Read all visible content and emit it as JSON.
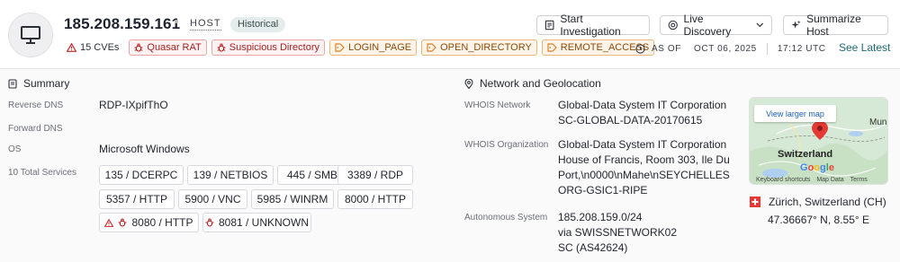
{
  "header": {
    "ip": "185.208.159.161",
    "type_label": "HOST",
    "status_badge": "Historical",
    "tags": [
      {
        "label": "15 CVEs",
        "style": "plain",
        "icon": "warning-icon"
      },
      {
        "label": "Quasar RAT",
        "style": "red",
        "icon": "bug-icon"
      },
      {
        "label": "Suspicious Directory",
        "style": "red",
        "icon": "bug-icon"
      },
      {
        "label": "LOGIN_PAGE",
        "style": "orange",
        "icon": "tag-icon"
      },
      {
        "label": "OPEN_DIRECTORY",
        "style": "orange",
        "icon": "tag-icon"
      },
      {
        "label": "REMOTE_ACCESS",
        "style": "orange",
        "icon": "tag-icon"
      }
    ],
    "actions": {
      "start_investigation": "Start Investigation",
      "live_discovery": "Live Discovery",
      "summarize_host": "Summarize Host"
    },
    "as_of": {
      "label": "AS OF",
      "date": "OCT 06, 2025",
      "time": "17:12 UTC",
      "see_latest": "See Latest"
    }
  },
  "summary": {
    "title": "Summary",
    "reverse_dns_label": "Reverse DNS",
    "reverse_dns_value": "RDP-IXpifThO",
    "forward_dns_label": "Forward DNS",
    "os_label": "OS",
    "os_value": "Microsoft Windows",
    "services_label": "10 Total Services",
    "services": [
      {
        "label": "135 / DCERPC",
        "warning": false
      },
      {
        "label": "139 / NETBIOS",
        "warning": false
      },
      {
        "label": "445 / SMB",
        "warning": false
      },
      {
        "label": "3389 / RDP",
        "warning": false
      },
      {
        "label": "5357 / HTTP",
        "warning": false
      },
      {
        "label": "5900 / VNC",
        "warning": false
      },
      {
        "label": "5985 / WINRM",
        "warning": false
      },
      {
        "label": "8000 / HTTP",
        "warning": false
      },
      {
        "label": "8080 / HTTP",
        "warning": true,
        "bug": true
      },
      {
        "label": "8081 / UNKNOWN",
        "warning": false,
        "bug": true
      }
    ]
  },
  "network": {
    "title": "Network and Geolocation",
    "whois_network_label": "WHOIS Network",
    "whois_network_lines": [
      "Global-Data System IT Corporation",
      "SC-GLOBAL-DATA-20170615"
    ],
    "whois_org_label": "WHOIS Organization",
    "whois_org_lines": [
      "Global-Data System IT Corporation",
      "House of Francis, Room 303, Ile Du",
      "Port,\\n0000\\nMahe\\nSEYCHELLES",
      "ORG-GSIC1-RIPE"
    ],
    "as_label": "Autonomous System",
    "as_lines": [
      "185.208.159.0/24",
      "via SWISSNETWORK02",
      "SC (AS42624)"
    ],
    "map": {
      "view_larger": "View larger map",
      "country": "Switzerland",
      "city_fragment": "Mun",
      "logo": "Google",
      "footer": [
        "Keyboard shortcuts",
        "Map Data",
        "Terms"
      ]
    },
    "location": "Zürich, Switzerland (CH)",
    "coordinates": "47.36667° N, 8.55° E"
  },
  "colors": {
    "accent": "#1d6b72",
    "danger": "#c62828",
    "warning_orange": "#d9822b"
  }
}
